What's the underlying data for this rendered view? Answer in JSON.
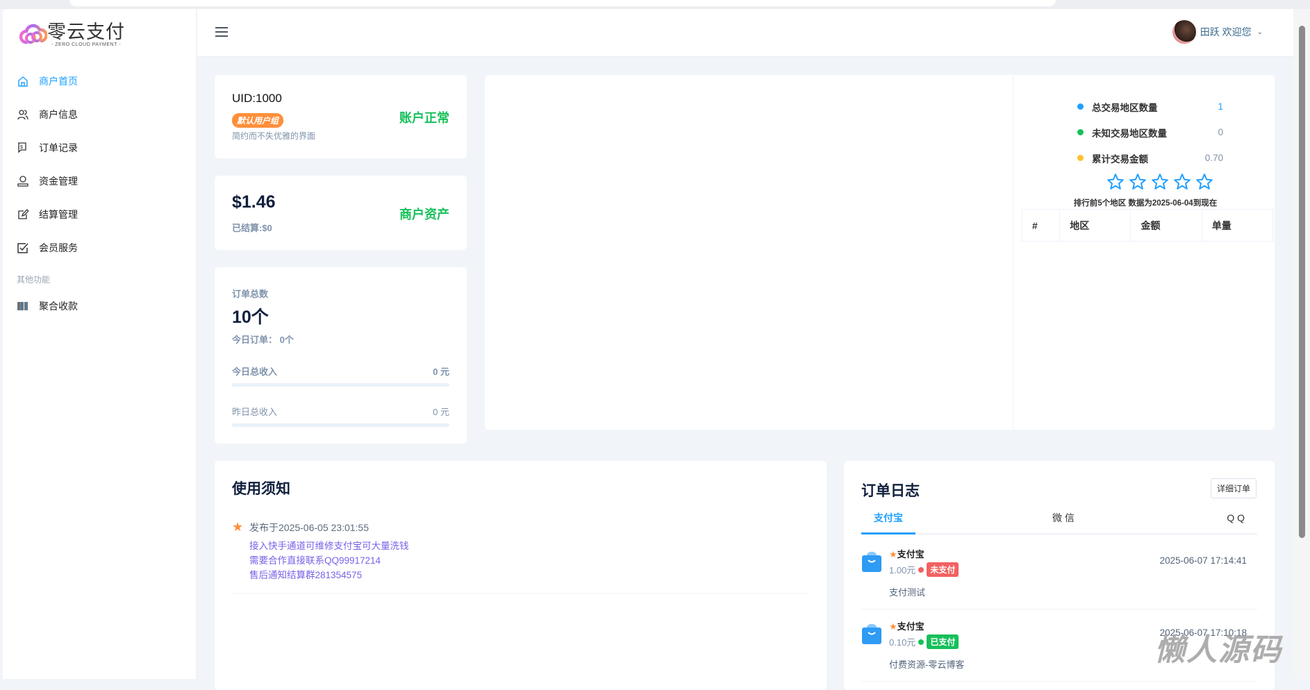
{
  "brand": {
    "name": "零云支付",
    "tagline": "- ZERO CLOUD PAYMENT -"
  },
  "sidebar": {
    "items": [
      {
        "label": "商户首页",
        "icon": "home-icon"
      },
      {
        "label": "商户信息",
        "icon": "users-icon"
      },
      {
        "label": "订单记录",
        "icon": "order-icon"
      },
      {
        "label": "资金管理",
        "icon": "money-icon"
      },
      {
        "label": "结算管理",
        "icon": "edit-icon"
      },
      {
        "label": "会员服务",
        "icon": "check-square-icon"
      }
    ],
    "group": "其他功能",
    "extra": [
      {
        "label": "聚合收款",
        "icon": "barcode-icon"
      }
    ]
  },
  "header": {
    "user": "田跃 欢迎您"
  },
  "account": {
    "uid": "UID:1000",
    "group_badge": "默认用户组",
    "slogan": "简约而不失优雅的界面",
    "status": "账户正常"
  },
  "assets": {
    "balance": "$1.46",
    "settled": "已结算:$0",
    "label": "商户资产"
  },
  "orders": {
    "title": "订单总数",
    "total": "10个",
    "today": "今日订单：  0个",
    "today_income_label": "今日总收入",
    "today_income": "0 元",
    "yesterday_income_label": "昨日总收入",
    "yesterday_income": "0 元",
    "today_progress": 0,
    "yesterday_progress": 0
  },
  "region": {
    "stats": [
      {
        "label": "总交易地区数量",
        "value": "1",
        "color": "#1e9fff"
      },
      {
        "label": "未知交易地区数量",
        "value": "0",
        "color": "#16c05a"
      },
      {
        "label": "累计交易金额",
        "value": "0.70",
        "color": "#ffc12e"
      }
    ],
    "rating": 0,
    "rating_max": 5,
    "caption": "排行前5个地区  数据为2025-06-04到现在",
    "columns": [
      "#",
      "地区",
      "金额",
      "单量"
    ]
  },
  "notice": {
    "title": "使用须知",
    "published": "发布于2025-06-05 23:01:55",
    "lines": [
      "接入快手通道可维修支付宝可大量洗钱",
      "需要合作直接联系QQ99917214",
      "售后通知结算群281354575"
    ]
  },
  "orderlog": {
    "title": "订单日志",
    "detail_button": "详细订单",
    "tabs": [
      "支付宝",
      "微 信",
      "Q Q"
    ],
    "items": [
      {
        "channel": "支付宝",
        "amount": "1.00元",
        "status": "未支付",
        "status_color": "#f26161",
        "time": "2025-06-07 17:14:41",
        "desc": "支付测试"
      },
      {
        "channel": "支付宝",
        "amount": "0.10元",
        "status": "已支付",
        "status_color": "#16c05a",
        "time": "2025-06-07 17:10:18",
        "desc": "付费资源-零云博客"
      }
    ]
  },
  "watermark": "懒人源码"
}
